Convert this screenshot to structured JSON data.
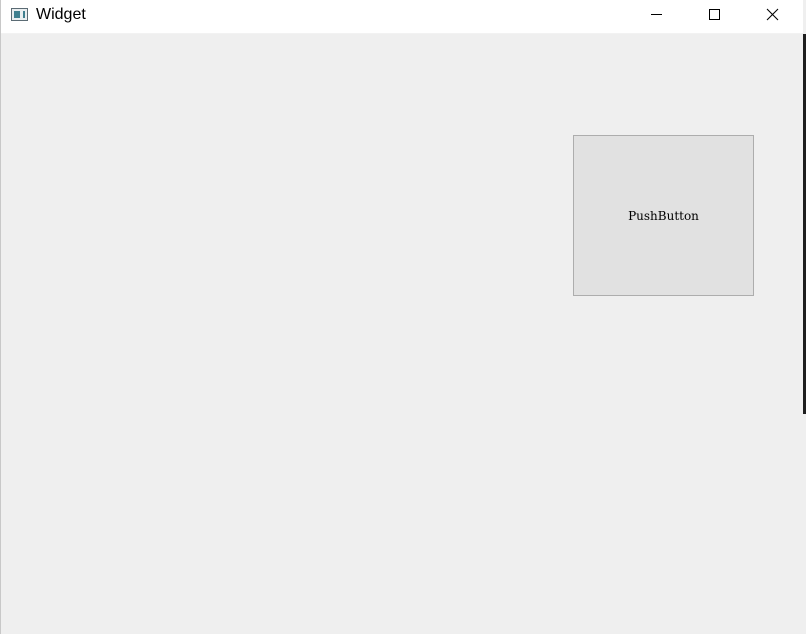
{
  "window": {
    "title": "Widget",
    "icon": "qt-window-icon"
  },
  "controls": {
    "minimize": "minimize-icon",
    "maximize": "maximize-icon",
    "close": "close-icon"
  },
  "content": {
    "button_label": "PushButton"
  },
  "colors": {
    "background": "#efefef",
    "titlebar": "#ffffff",
    "button_face": "#e1e1e1",
    "button_border": "#adadad"
  }
}
